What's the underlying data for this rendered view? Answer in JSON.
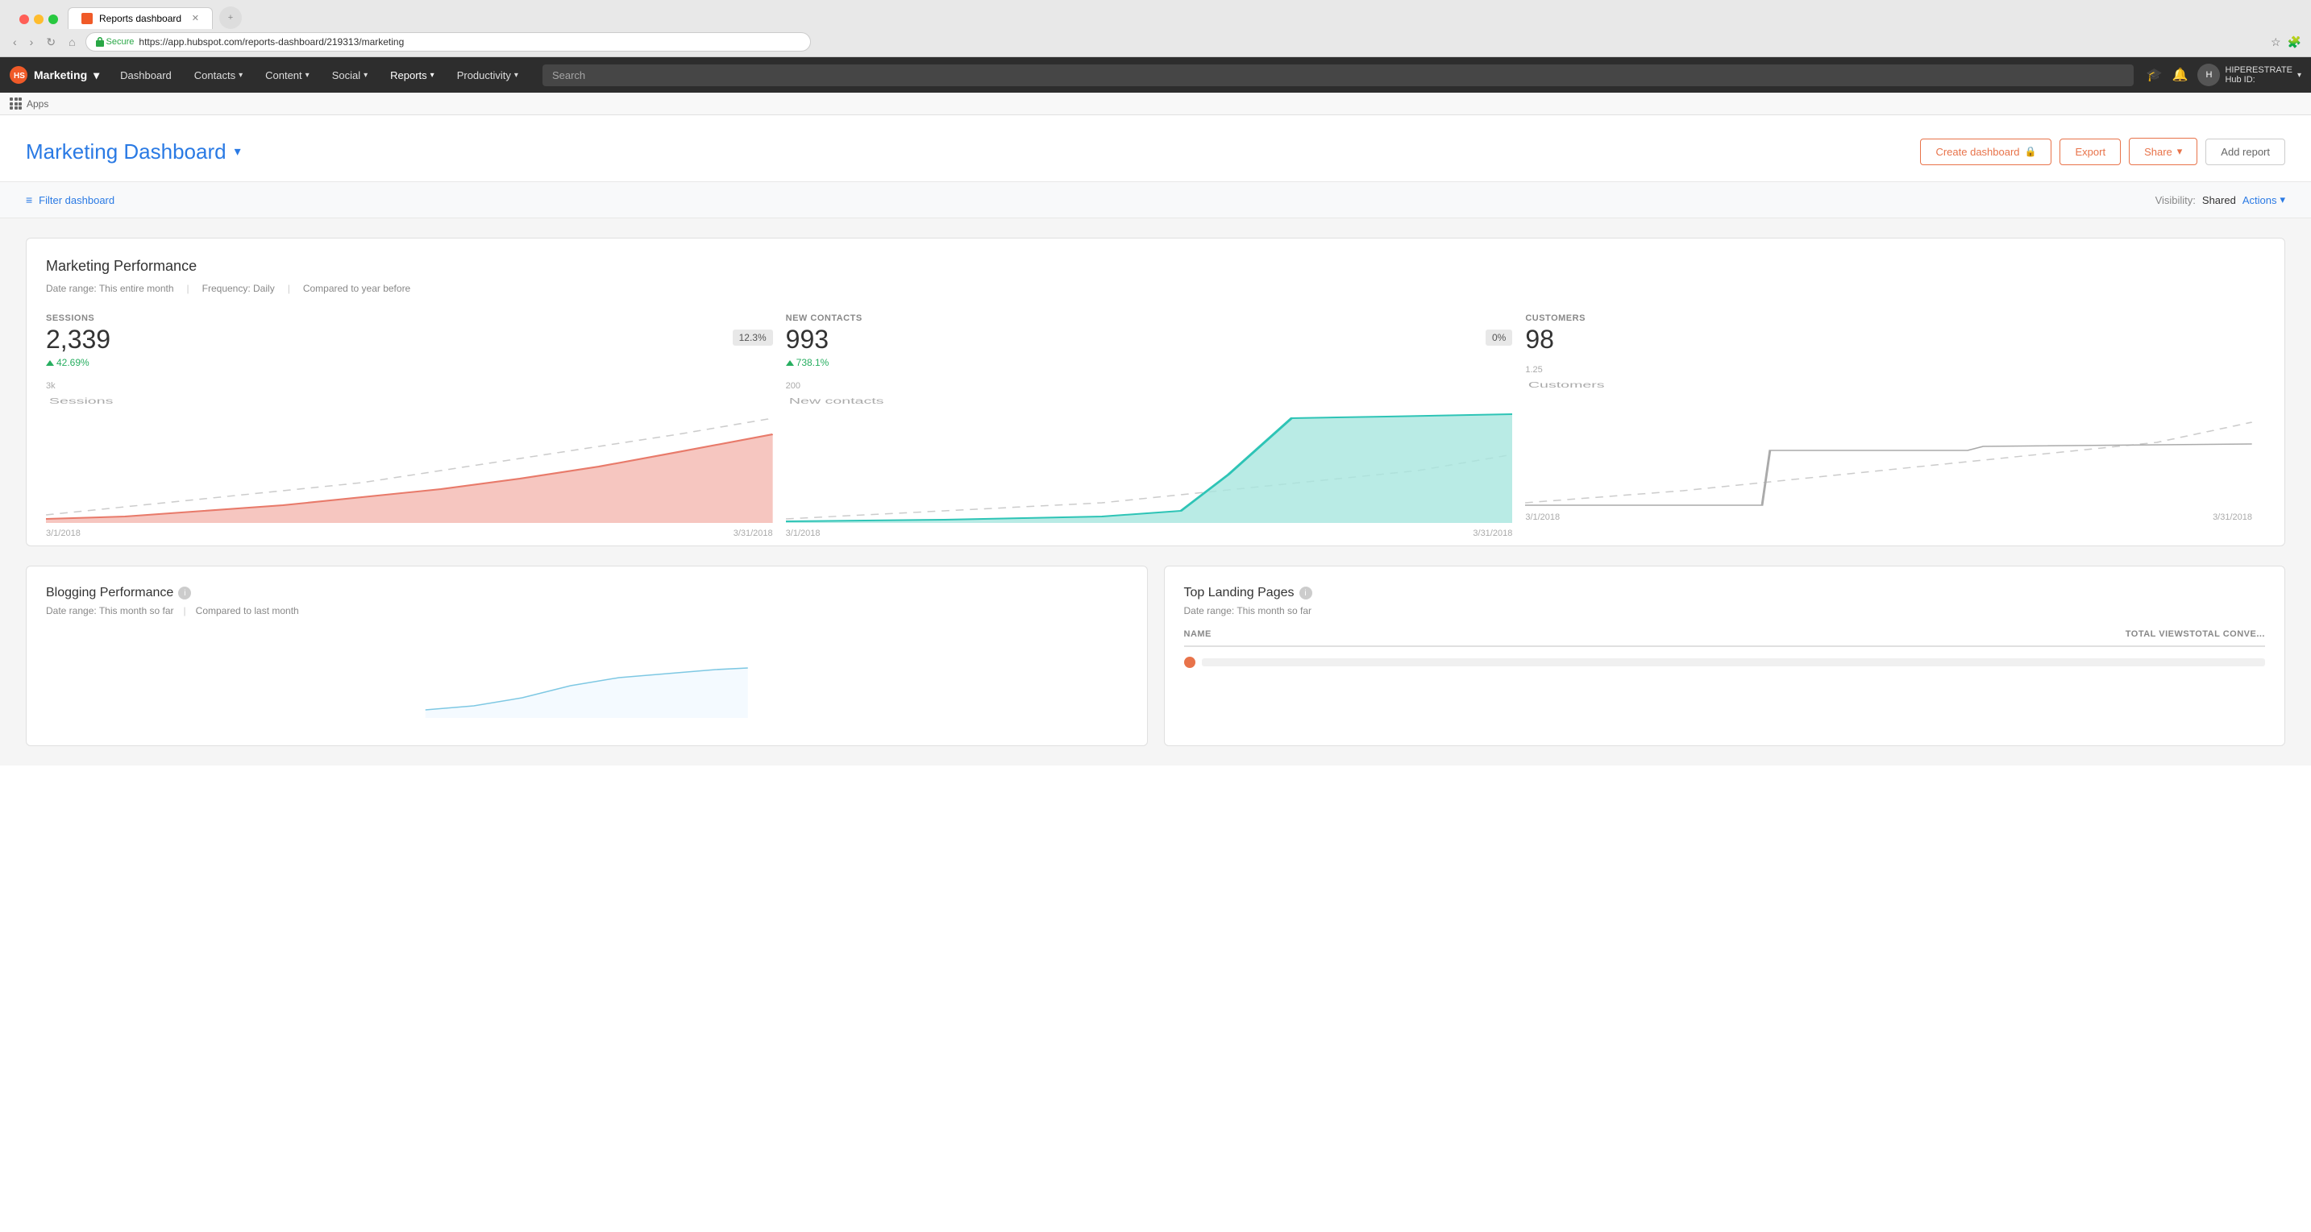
{
  "browser": {
    "tab_title": "Reports dashboard",
    "url": "https://app.hubspot.com/reports-dashboard/219313/marketing",
    "secure_label": "Secure"
  },
  "nav": {
    "brand": "Marketing",
    "items": [
      "Dashboard",
      "Contacts",
      "Content",
      "Social",
      "Reports",
      "Productivity"
    ],
    "search_placeholder": "Search",
    "user_name": "HIPERESTRATE",
    "hub_id_label": "Hub ID:"
  },
  "apps_bar": {
    "label": "Apps"
  },
  "header": {
    "title": "Marketing Dashboard",
    "create_dashboard_btn": "Create dashboard",
    "export_btn": "Export",
    "share_btn": "Share",
    "add_report_btn": "Add report"
  },
  "filter_bar": {
    "filter_label": "Filter dashboard",
    "visibility_label": "Visibility:",
    "visibility_value": "Shared",
    "actions_label": "Actions"
  },
  "marketing_performance": {
    "title": "Marketing Performance",
    "date_range": "Date range: This entire month",
    "frequency": "Frequency: Daily",
    "compared": "Compared to year before",
    "metrics": [
      {
        "label": "SESSIONS",
        "value": "2,339",
        "change": "42.69%",
        "badge": "12.3%",
        "positive": true,
        "date_start": "3/1/2018",
        "date_end": "3/31/2018",
        "y_max": "3k"
      },
      {
        "label": "NEW CONTACTS",
        "value": "993",
        "change": "738.1%",
        "badge": "0%",
        "positive": true,
        "date_start": "3/1/2018",
        "date_end": "3/31/2018",
        "y_max": "200"
      },
      {
        "label": "CUSTOMERS",
        "value": "98",
        "change": null,
        "badge": null,
        "positive": true,
        "date_start": "3/1/2018",
        "date_end": "3/31/2018",
        "y_max": "1.25"
      }
    ]
  },
  "blogging_performance": {
    "title": "Blogging Performance",
    "date_range": "Date range: This month so far",
    "compared": "Compared to last month"
  },
  "top_landing_pages": {
    "title": "Top Landing Pages",
    "date_range": "Date range: This month so far",
    "col_name": "NAME",
    "col_views": "TOTAL VIEWS",
    "col_conversions": "TOTAL CONVE..."
  },
  "colors": {
    "accent": "#2a7ae4",
    "orange": "#e8734a",
    "sessions_fill": "#f4b8b0",
    "sessions_line": "#e87a6a",
    "contacts_fill": "#a8e6df",
    "contacts_line": "#2ec4b6",
    "customers_line": "#999",
    "dashed_line": "#ccc"
  }
}
